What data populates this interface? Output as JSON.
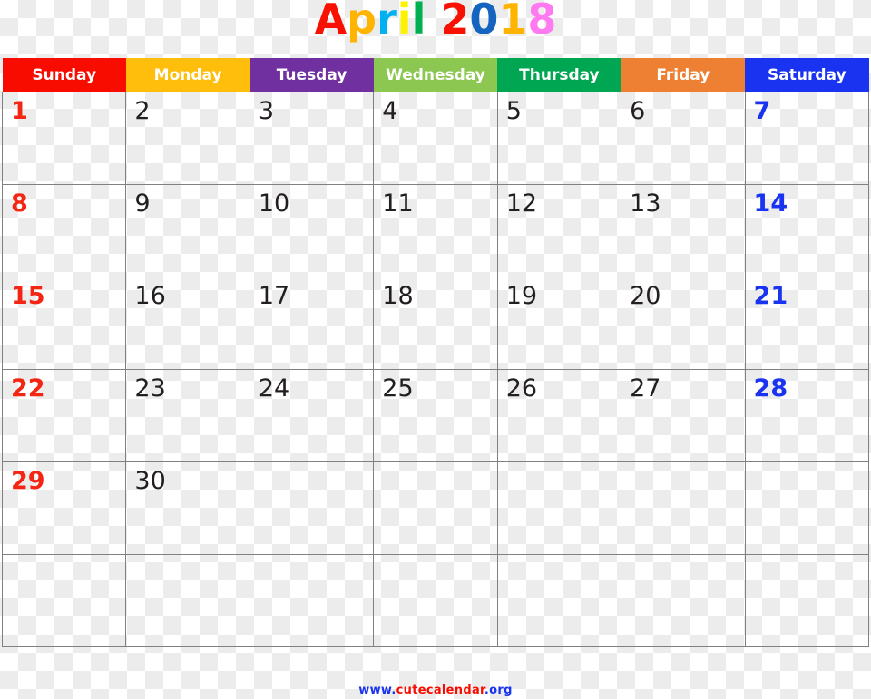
{
  "title": {
    "text": "April 2018",
    "month": "April",
    "year": "2018",
    "letters": [
      {
        "char": "A",
        "color": "#f81000"
      },
      {
        "char": "p",
        "color": "#ffb400"
      },
      {
        "char": "r",
        "color": "#00b0f0"
      },
      {
        "char": "i",
        "color": "#fff200"
      },
      {
        "char": "l",
        "color": "#00b050"
      },
      {
        "char": " ",
        "color": "#000000"
      },
      {
        "char": "2",
        "color": "#f81000"
      },
      {
        "char": "0",
        "color": "#1565c0"
      },
      {
        "char": "1",
        "color": "#ffb400"
      },
      {
        "char": "8",
        "color": "#ff7af0"
      }
    ]
  },
  "header": {
    "days": [
      {
        "label": "Sunday",
        "bg": "#f80c00",
        "fg": "#ffffff"
      },
      {
        "label": "Monday",
        "bg": "#ffbe0b",
        "fg": "#ffffff"
      },
      {
        "label": "Tuesday",
        "bg": "#7030a0",
        "fg": "#ffffff"
      },
      {
        "label": "Wednesday",
        "bg": "#8cc751",
        "fg": "#ffffff"
      },
      {
        "label": "Thursday",
        "bg": "#00a651",
        "fg": "#ffffff"
      },
      {
        "label": "Friday",
        "bg": "#ed8033",
        "fg": "#ffffff"
      },
      {
        "label": "Saturday",
        "bg": "#1a33f0",
        "fg": "#ffffff"
      }
    ]
  },
  "grid": {
    "weeks": [
      [
        {
          "day": "1",
          "kind": "sunday"
        },
        {
          "day": "2",
          "kind": "weekday"
        },
        {
          "day": "3",
          "kind": "weekday"
        },
        {
          "day": "4",
          "kind": "weekday"
        },
        {
          "day": "5",
          "kind": "weekday"
        },
        {
          "day": "6",
          "kind": "weekday"
        },
        {
          "day": "7",
          "kind": "saturday"
        }
      ],
      [
        {
          "day": "8",
          "kind": "sunday"
        },
        {
          "day": "9",
          "kind": "weekday"
        },
        {
          "day": "10",
          "kind": "weekday"
        },
        {
          "day": "11",
          "kind": "weekday"
        },
        {
          "day": "12",
          "kind": "weekday"
        },
        {
          "day": "13",
          "kind": "weekday"
        },
        {
          "day": "14",
          "kind": "saturday"
        }
      ],
      [
        {
          "day": "15",
          "kind": "sunday"
        },
        {
          "day": "16",
          "kind": "weekday"
        },
        {
          "day": "17",
          "kind": "weekday"
        },
        {
          "day": "18",
          "kind": "weekday"
        },
        {
          "day": "19",
          "kind": "weekday"
        },
        {
          "day": "20",
          "kind": "weekday"
        },
        {
          "day": "21",
          "kind": "saturday"
        }
      ],
      [
        {
          "day": "22",
          "kind": "sunday"
        },
        {
          "day": "23",
          "kind": "weekday"
        },
        {
          "day": "24",
          "kind": "weekday"
        },
        {
          "day": "25",
          "kind": "weekday"
        },
        {
          "day": "26",
          "kind": "weekday"
        },
        {
          "day": "27",
          "kind": "weekday"
        },
        {
          "day": "28",
          "kind": "saturday"
        }
      ],
      [
        {
          "day": "29",
          "kind": "sunday"
        },
        {
          "day": "30",
          "kind": "weekday"
        },
        {
          "day": "",
          "kind": "empty"
        },
        {
          "day": "",
          "kind": "empty"
        },
        {
          "day": "",
          "kind": "empty"
        },
        {
          "day": "",
          "kind": "empty"
        },
        {
          "day": "",
          "kind": "empty"
        }
      ],
      [
        {
          "day": "",
          "kind": "empty"
        },
        {
          "day": "",
          "kind": "empty"
        },
        {
          "day": "",
          "kind": "empty"
        },
        {
          "day": "",
          "kind": "empty"
        },
        {
          "day": "",
          "kind": "empty"
        },
        {
          "day": "",
          "kind": "empty"
        },
        {
          "day": "",
          "kind": "empty"
        }
      ]
    ]
  },
  "footer": {
    "text": "www.cutecalendar.org",
    "parts": [
      {
        "char": "www",
        "color": "#1a33f0"
      },
      {
        "char": ".",
        "color": "#1a33f0"
      },
      {
        "char": "cutecalendar",
        "color": "#f80c00"
      },
      {
        "char": ".org",
        "color": "#1a33f0"
      }
    ]
  },
  "colors": {
    "grid_line": "#808080",
    "weekday_text": "#231f20",
    "sunday_text": "#f22613",
    "saturday_text": "#1a33f0"
  }
}
